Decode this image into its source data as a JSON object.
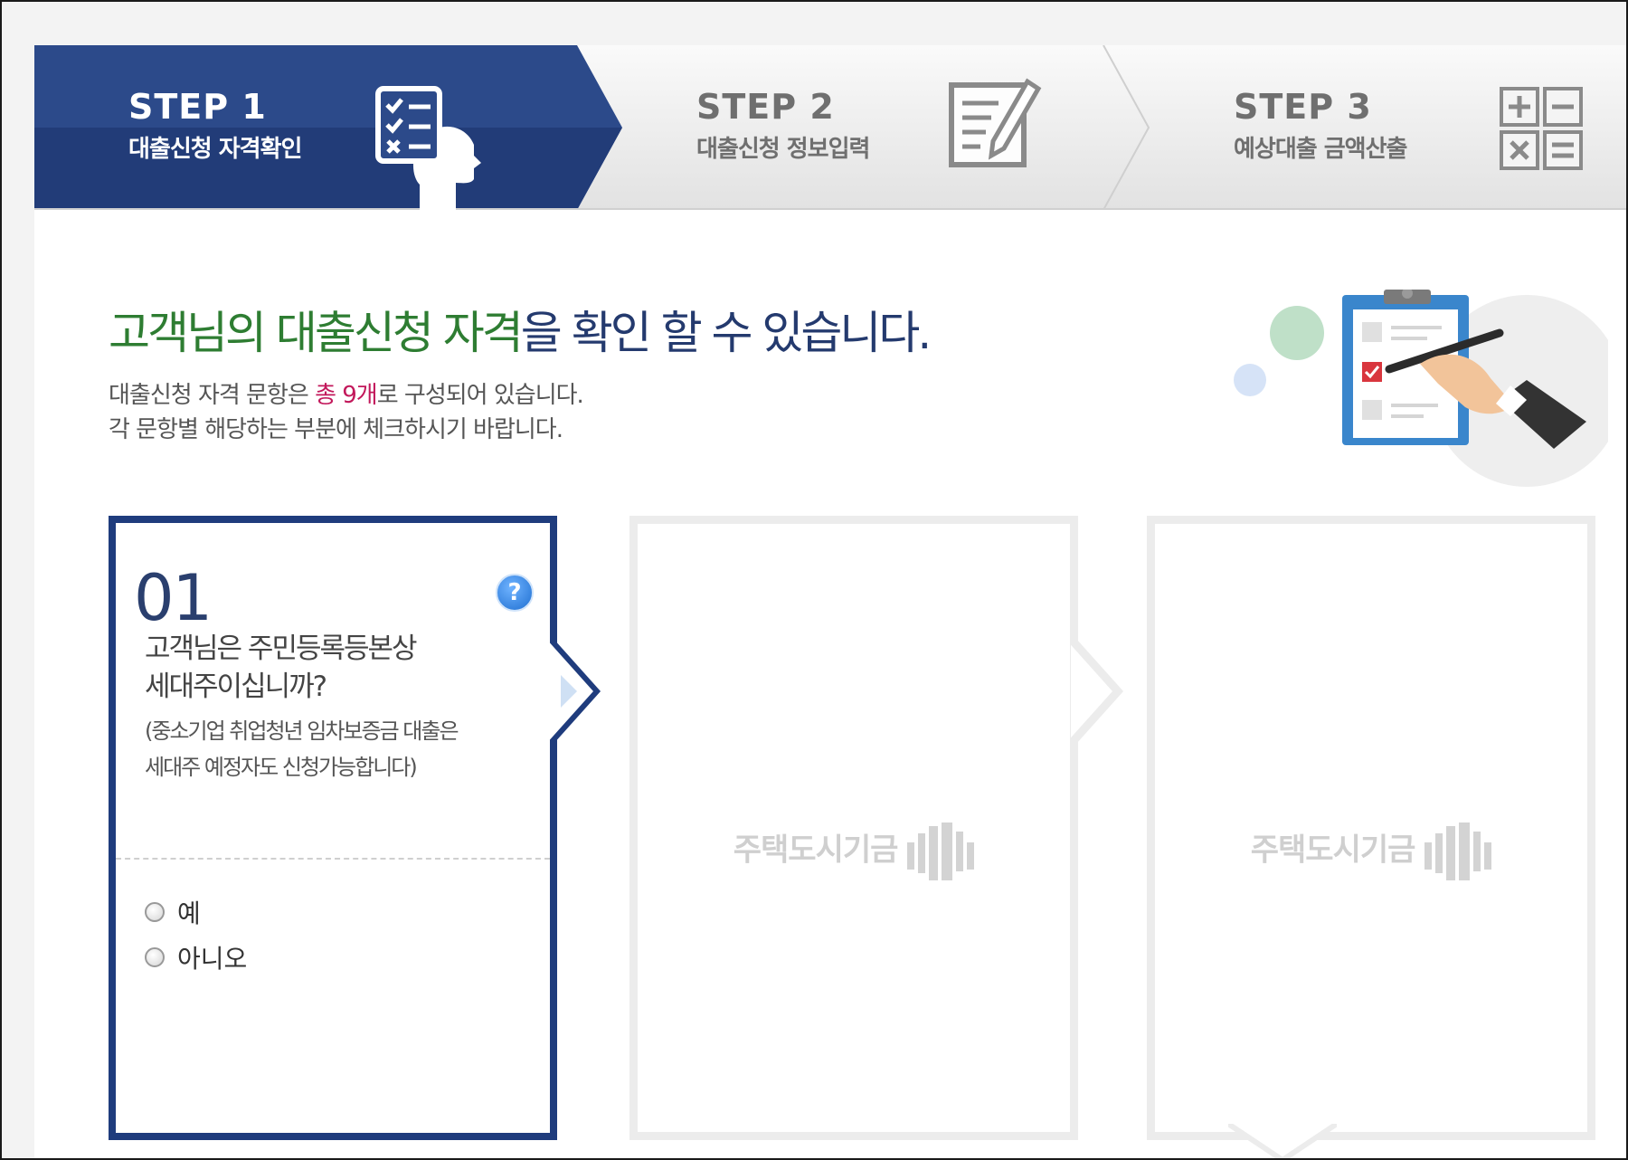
{
  "steps": [
    {
      "title": "STEP 1",
      "sub": "대출신청 자격확인",
      "state": "active",
      "icon": "checklist-person-icon"
    },
    {
      "title": "STEP 2",
      "sub": "대출신청 정보입력",
      "state": "inactive",
      "icon": "edit-document-icon"
    },
    {
      "title": "STEP 3",
      "sub": "예상대출 금액산출",
      "state": "inactive",
      "icon": "calculator-icon"
    }
  ],
  "heading": {
    "part1": "고객님의 대출신청 자격",
    "part2": "을 확인 할 수 있습니다."
  },
  "desc": {
    "line1_a": "대출신청 자격 문항은 ",
    "line1_b": "총 9개",
    "line1_c": "로 구성되어 있습니다.",
    "line2": "각 문항별 해당하는 부분에 체크하시기 바랍니다."
  },
  "question": {
    "number": "01",
    "text_line1": "고객님은 주민등록등본상",
    "text_line2": "세대주이십니까?",
    "note_line1": "(중소기업 취업청년 임차보증금 대출은",
    "note_line2": "세대주 예정자도 신청가능합니다)",
    "help": "?",
    "options": [
      "예",
      "아니오"
    ]
  },
  "placeholder_text": "주택도시기금",
  "colors": {
    "active_step": "#2c4a8a",
    "green_accent": "#2e7d32",
    "navy_text": "#243a6e",
    "red_accent": "#c2185b"
  }
}
